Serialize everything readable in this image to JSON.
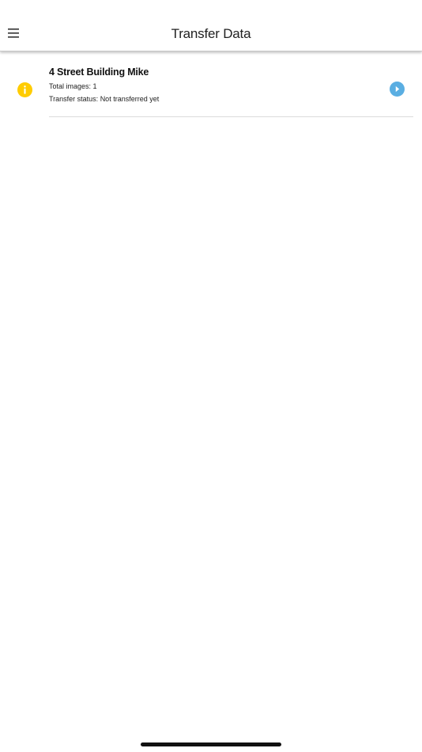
{
  "header": {
    "title": "Transfer Data",
    "menu_icon": "hamburger-menu-icon"
  },
  "transfers": [
    {
      "name": "4 Street Building Mike",
      "total_images": "Total images: 1",
      "status": "Transfer status: Not transferred yet",
      "status_icon": "info-icon",
      "action_icon": "chevron-right-circle-icon"
    }
  ],
  "colors": {
    "info_icon": "#FFCC00",
    "action_icon": "#5AAEE2",
    "divider": "#DCDCDC",
    "header_shadow": "#C9C9C9"
  }
}
